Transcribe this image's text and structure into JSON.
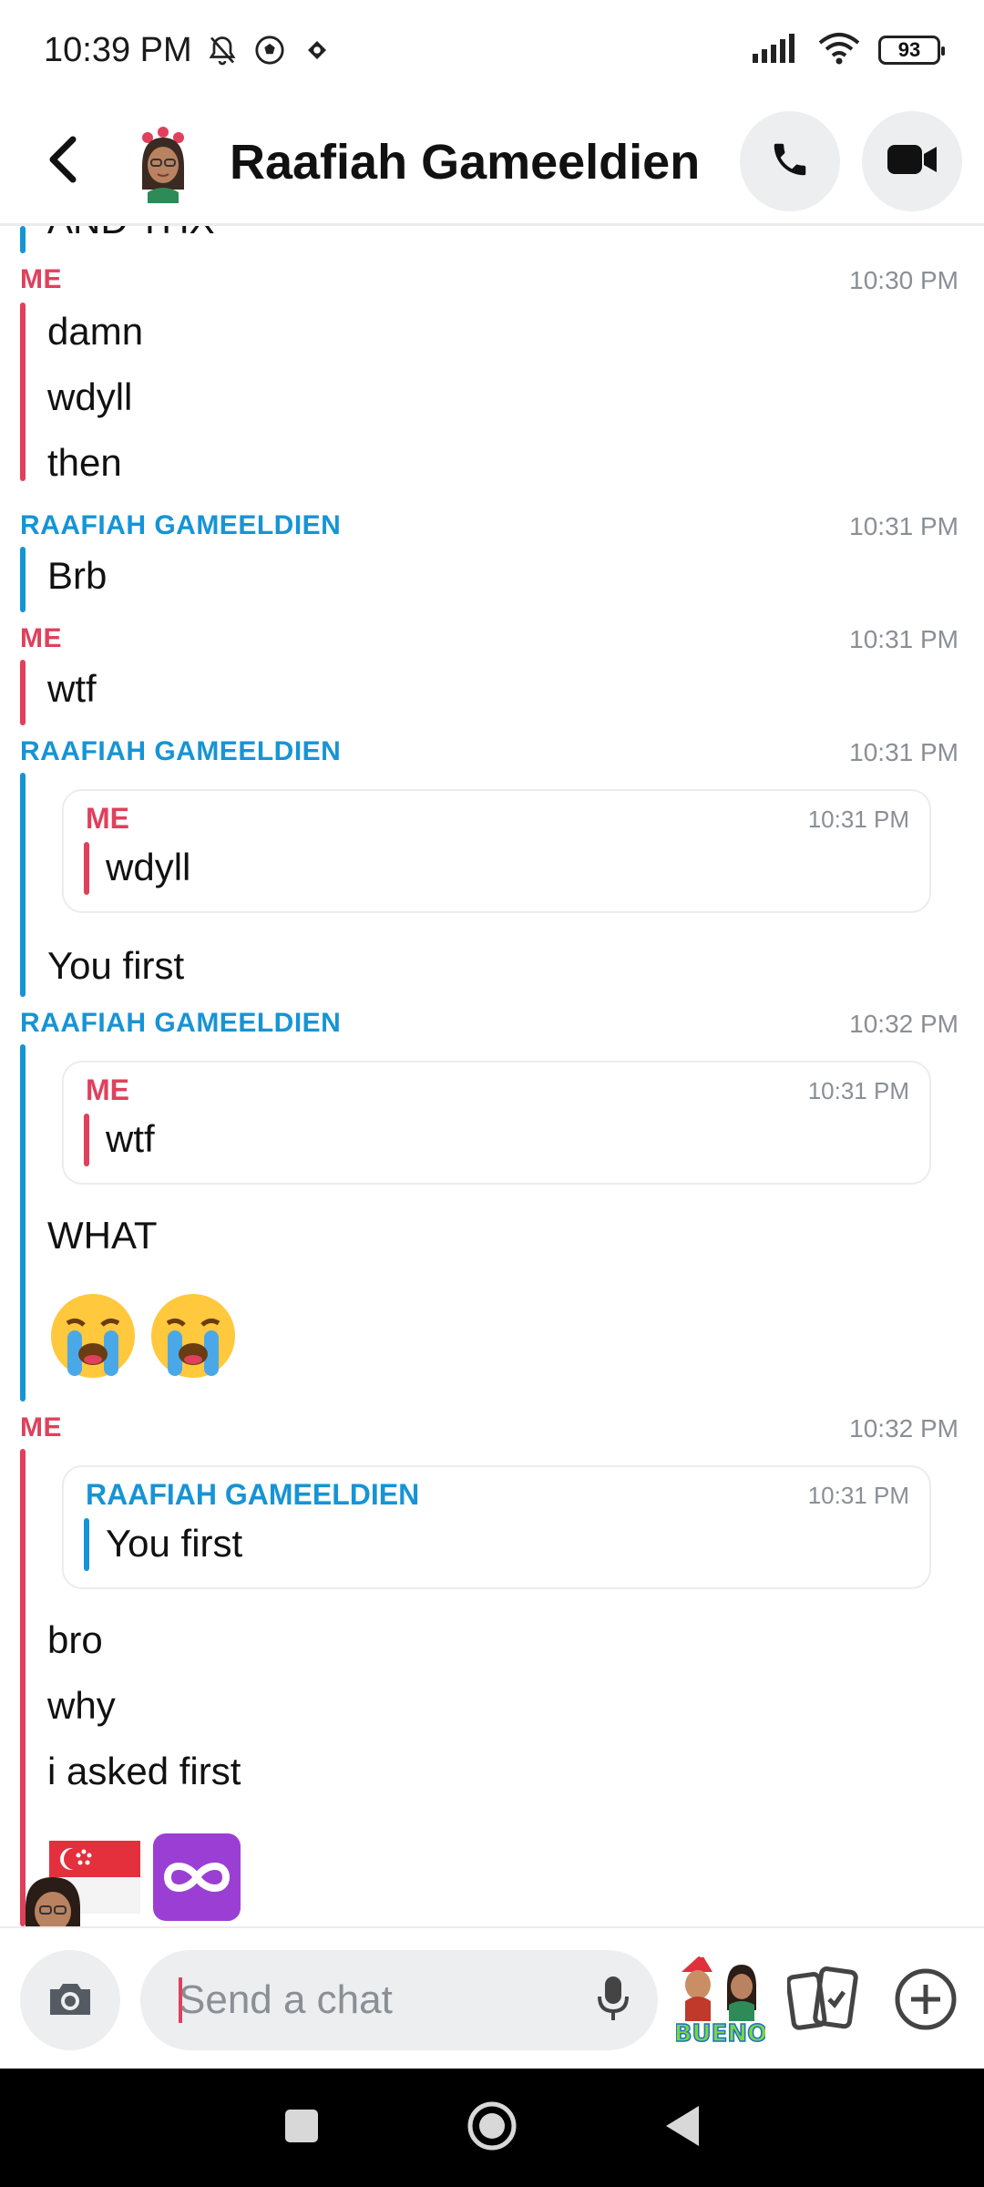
{
  "status_bar": {
    "time": "10:39 PM",
    "battery": "93"
  },
  "header": {
    "contact_name": "Raafiah Gameeldien"
  },
  "chat": {
    "cut_text": "AND THX",
    "groups": [
      {
        "sender": "ME",
        "time": "10:30 PM",
        "lines": [
          "damn",
          "wdyll",
          "then"
        ]
      },
      {
        "sender": "RAAFIAH GAMEELDIEN",
        "time": "10:31 PM",
        "lines": [
          "Brb"
        ]
      },
      {
        "sender": "ME",
        "time": "10:31 PM",
        "lines": [
          "wtf"
        ]
      },
      {
        "sender": "RAAFIAH GAMEELDIEN",
        "time": "10:31 PM",
        "quote": {
          "sender": "ME",
          "time": "10:31 PM",
          "text": "wdyll"
        },
        "lines": [
          "You first"
        ]
      },
      {
        "sender": "RAAFIAH GAMEELDIEN",
        "time": "10:32 PM",
        "quote": {
          "sender": "ME",
          "time": "10:31 PM",
          "text": "wtf"
        },
        "lines": [
          "WHAT"
        ],
        "emojis": [
          "😭",
          "😭"
        ]
      },
      {
        "sender": "ME",
        "time": "10:32 PM",
        "quote": {
          "sender": "RAAFIAH GAMEELDIEN",
          "time": "10:31 PM",
          "text": "You first"
        },
        "lines": [
          "bro",
          "why",
          "i asked first"
        ],
        "emojis": [
          "🇸🇬",
          "♾️"
        ]
      }
    ]
  },
  "input": {
    "placeholder": "Send a chat"
  },
  "colors": {
    "me": "#e0405c",
    "friend": "#1694d6",
    "timestamp": "#8a8f96"
  },
  "icons": [
    "back-arrow-icon",
    "phone-icon",
    "video-camera-icon",
    "camera-icon",
    "microphone-icon",
    "bitmoji-icon",
    "cards-icon",
    "plus-icon",
    "mute-icon",
    "soccer-icon",
    "signal-icon",
    "wifi-icon"
  ]
}
